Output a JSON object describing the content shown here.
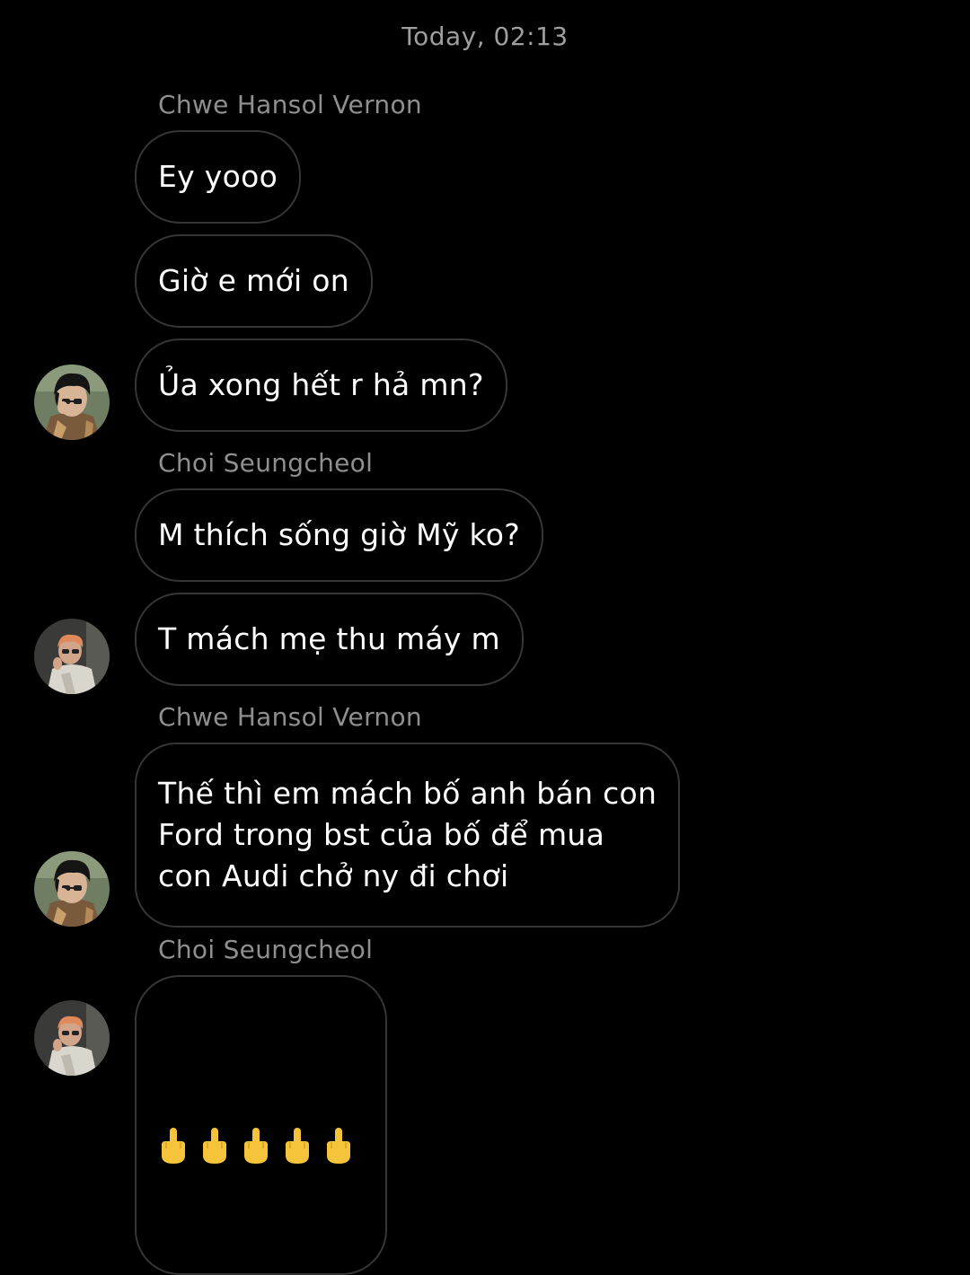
{
  "header": {
    "timestamp": "Today, 02:13"
  },
  "groups": [
    {
      "sender": "Chwe Hansol Vernon",
      "messages": [
        "Ey yooo",
        "Giờ e mới on",
        "Ủa xong hết r hả mn?"
      ]
    },
    {
      "sender": "Choi Seungcheol",
      "messages": [
        "M thích sống giờ Mỹ ko?",
        "T mách mẹ thu máy m"
      ]
    },
    {
      "sender": "Chwe Hansol Vernon",
      "messages": [
        "Thế thì em mách bố anh bán con\nFord trong bst của bố để mua\ncon Audi chở ny đi chơi"
      ]
    },
    {
      "sender": "Choi Seungcheol",
      "messages": [
        "🖕🖕🖕🖕🖕"
      ]
    }
  ],
  "avatars": {
    "vernon_icon": "avatar-photo-dark-hair-glasses",
    "seungcheol_icon": "avatar-photo-orange-hair"
  },
  "colors": {
    "background": "#000000",
    "bubble_border": "#363636",
    "meta_text": "#8f8f8f",
    "emoji": "#f6c43a"
  }
}
